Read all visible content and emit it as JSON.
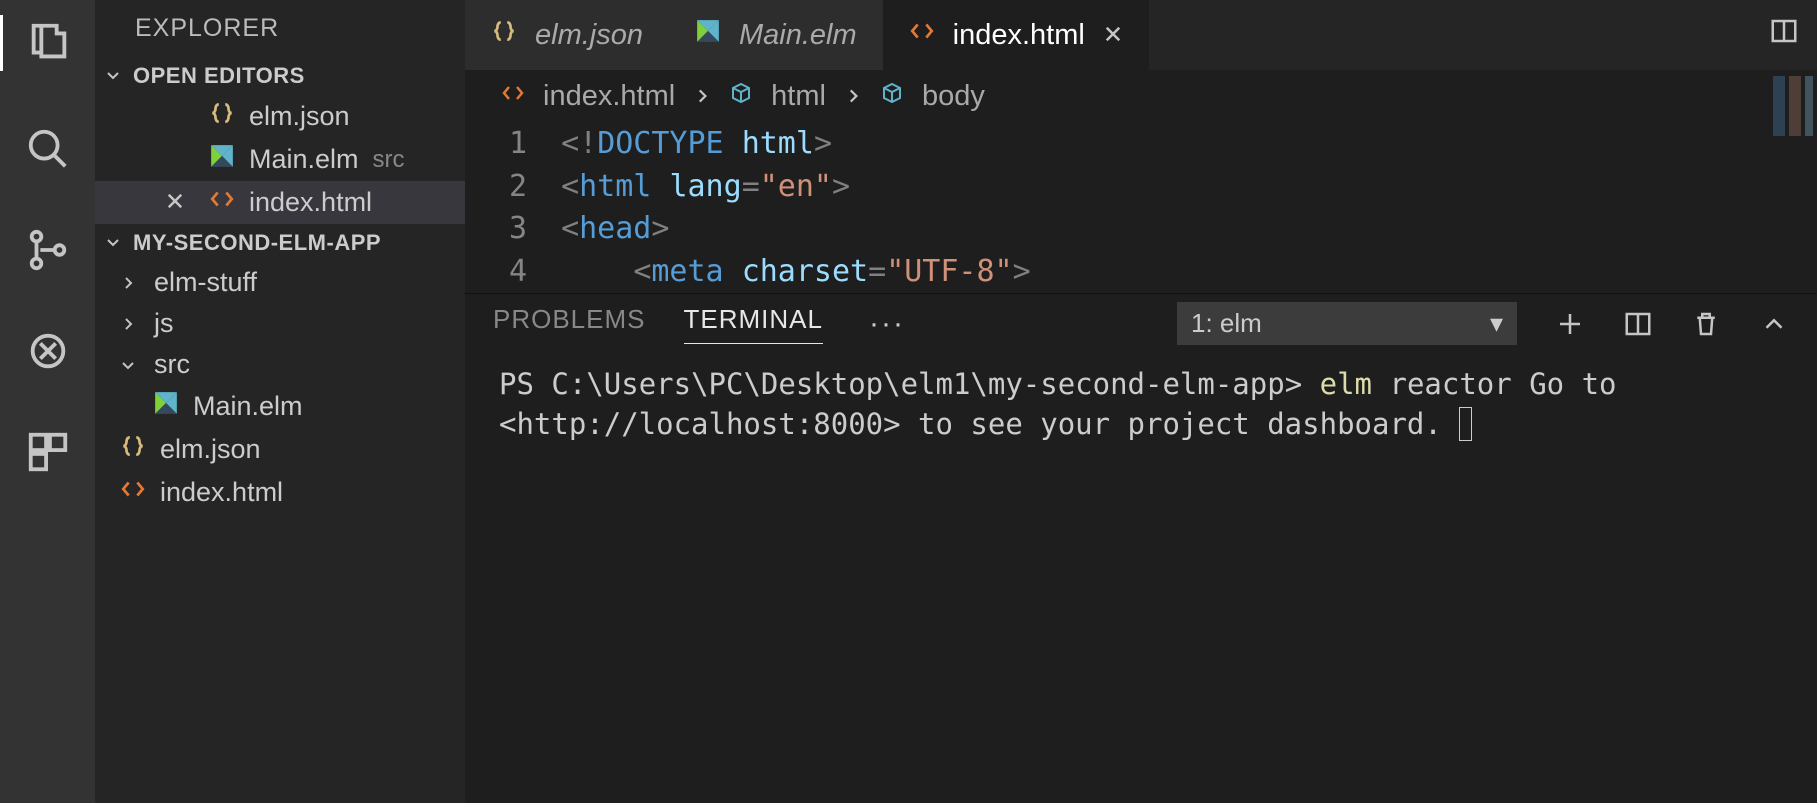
{
  "sidebar": {
    "title": "EXPLORER",
    "openEditorsLabel": "OPEN EDITORS",
    "openEditors": [
      {
        "name": "elm.json",
        "iconType": "json"
      },
      {
        "name": "Main.elm",
        "iconType": "elm",
        "detail": "src"
      },
      {
        "name": "index.html",
        "iconType": "html",
        "active": true
      }
    ],
    "projectLabel": "MY-SECOND-ELM-APP",
    "tree": [
      {
        "kind": "folder",
        "name": "elm-stuff",
        "expanded": false
      },
      {
        "kind": "folder",
        "name": "js",
        "expanded": false
      },
      {
        "kind": "folder",
        "name": "src",
        "expanded": true
      },
      {
        "kind": "file",
        "name": "Main.elm",
        "iconType": "elm",
        "indent": 1
      },
      {
        "kind": "file",
        "name": "elm.json",
        "iconType": "json"
      },
      {
        "kind": "file",
        "name": "index.html",
        "iconType": "html"
      }
    ]
  },
  "tabs": [
    {
      "name": "elm.json",
      "iconType": "json"
    },
    {
      "name": "Main.elm",
      "iconType": "elm"
    },
    {
      "name": "index.html",
      "iconType": "html",
      "active": true
    }
  ],
  "breadcrumbs": [
    {
      "label": "index.html",
      "iconType": "html",
      "iconBefore": true
    },
    {
      "label": "html",
      "iconType": "sym"
    },
    {
      "label": "body",
      "iconType": "sym"
    }
  ],
  "code": {
    "lines": [
      "1",
      "2",
      "3",
      "4"
    ],
    "l1": {
      "open": "<!",
      "doctype": "DOCTYPE",
      "sp": " ",
      "html": "html",
      "close": ">"
    },
    "l2": {
      "open": "<",
      "tag": "html",
      "sp": " ",
      "attr": "lang",
      "eq": "=",
      "val": "\"en\"",
      "close": ">"
    },
    "l3": {
      "open": "<",
      "tag": "head",
      "close": ">"
    },
    "l4": {
      "indent": "    ",
      "open": "<",
      "tag": "meta",
      "sp": " ",
      "attr": "charset",
      "eq": "=",
      "val": "\"UTF-8\"",
      "close": ">"
    }
  },
  "panel": {
    "tabs": {
      "problems": "PROBLEMS",
      "terminal": "TERMINAL"
    },
    "selectLabel": "1: elm",
    "terminal": {
      "promptPrefix": "PS ",
      "cwd": "C:\\Users\\PC\\Desktop\\elm1\\my-second-elm-app",
      "promptSuffix": ">",
      "cmd": "elm",
      "args": " reactor",
      "outL1_a": "Go to ",
      "outL1_b": "<http://localhost:8000>",
      "outL1_c": " to see your project dashboard."
    }
  },
  "icons": {
    "jsonColor": "#d7ba7d",
    "elmColor1": "#5fb4cb",
    "elmColor2": "#7fd13b",
    "htmlColor": "#e37933",
    "symColor": "#5fb4cb"
  }
}
